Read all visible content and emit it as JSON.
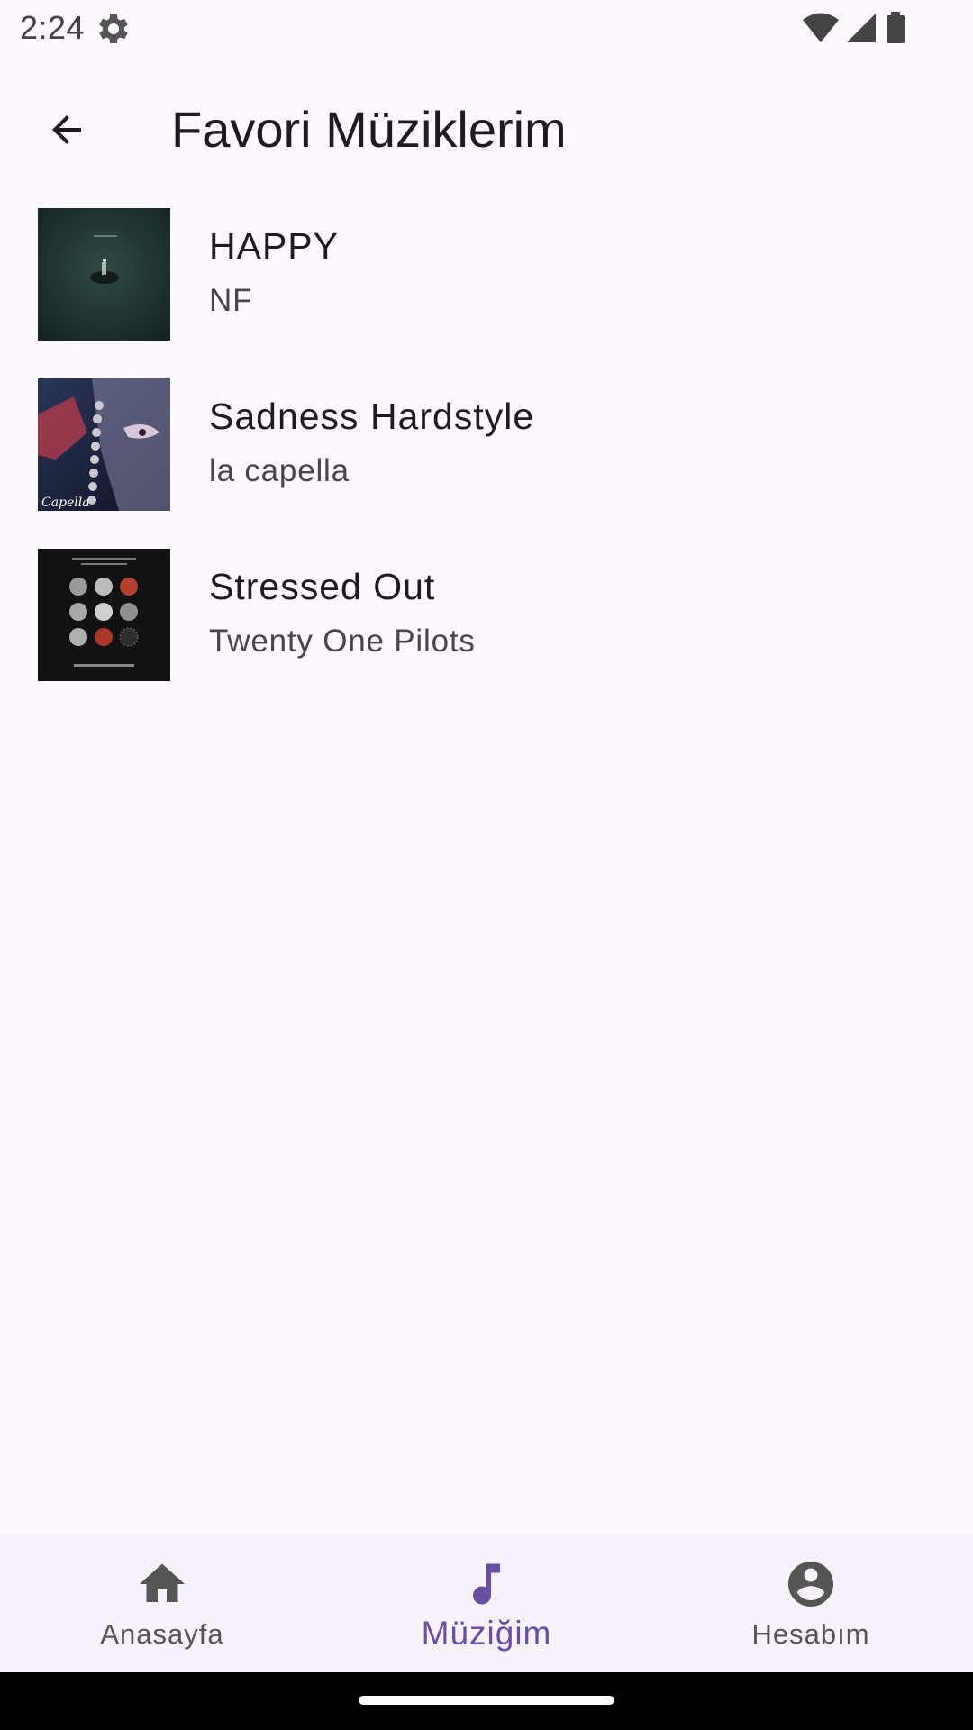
{
  "status_bar": {
    "time": "2:24",
    "icons": [
      "settings-gear-icon",
      "wifi-icon",
      "cell-signal-icon",
      "battery-icon"
    ]
  },
  "app_bar": {
    "back_icon": "arrow-back-icon",
    "title": "Favori Müziklerim"
  },
  "songs": [
    {
      "title": "HAPPY",
      "artist": "NF",
      "cover": "album-cover-happy"
    },
    {
      "title": "Sadness Hardstyle",
      "artist": "la capella",
      "cover": "album-cover-sadness-hardstyle"
    },
    {
      "title": "Stressed Out",
      "artist": "Twenty One Pilots",
      "cover": "album-cover-stressed-out"
    }
  ],
  "bottom_nav": {
    "items": [
      {
        "label": "Anasayfa",
        "icon": "home-icon",
        "active": false
      },
      {
        "label": "Müziğim",
        "icon": "music-note-icon",
        "active": true
      },
      {
        "label": "Hesabım",
        "icon": "account-circle-icon",
        "active": false
      }
    ]
  },
  "colors": {
    "background": "#fdf7fe",
    "accent": "#6750a4",
    "nav_background": "#f7f1fa"
  }
}
